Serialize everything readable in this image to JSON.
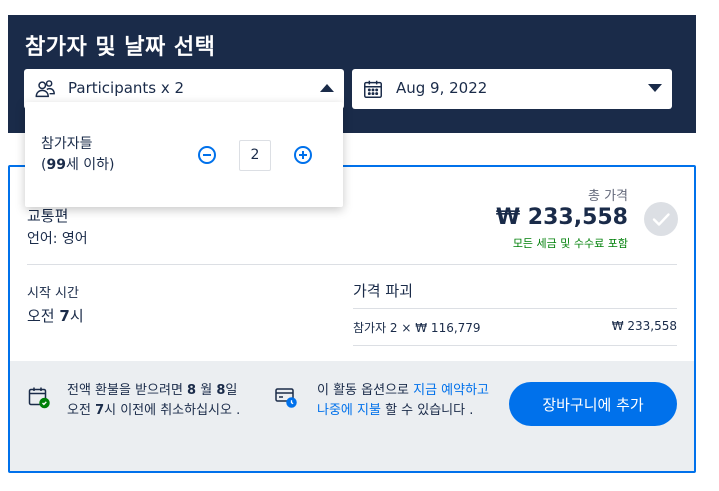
{
  "header": {
    "title": "참가자 및 날짜 선택",
    "participants_label": "Participants x 2",
    "date_label": "Aug 9, 2022"
  },
  "popup": {
    "label": "참가자들",
    "age_prefix": "(",
    "age_num": "99",
    "age_suffix": "세 이하)",
    "count": "2"
  },
  "option": {
    "name": "교통편",
    "language": "언어: 영어",
    "total_label": "총 가격",
    "total_price": "₩ 233,558",
    "total_note": "모든 세금 및 수수료 포함",
    "start_label": "시작 시간",
    "start_prefix": "오전 ",
    "start_num": "7",
    "start_suffix": "시",
    "breakdown_title": "가격 파괴",
    "breakdown_row_label": "참가자 2 × ₩ 116,779",
    "breakdown_row_price": "₩ 233,558"
  },
  "footer": {
    "refund_1": "전액 환불을 받으려면 ",
    "refund_2": "8",
    "refund_3": " 월 ",
    "refund_4": "8",
    "refund_5": "일 오전 ",
    "refund_6": "7",
    "refund_7": "시 이전에 취소하십시오 .",
    "reserve_1": "이 활동 옵션으로 ",
    "reserve_link1": "지금 예약하고 나중에 지불",
    "reserve_2": " 할 수 있습니다 .",
    "cart_button": "장바구니에 추가"
  },
  "colors": {
    "navy": "#1a2b49",
    "accent": "#0071eb",
    "green": "#008009",
    "footer_bg": "#ebeef1"
  },
  "icons": [
    "participants-icon",
    "calendar-icon",
    "caret-up-icon",
    "caret-down-icon",
    "check-icon",
    "calendar-check-icon",
    "card-clock-icon",
    "minus-icon",
    "plus-icon"
  ]
}
